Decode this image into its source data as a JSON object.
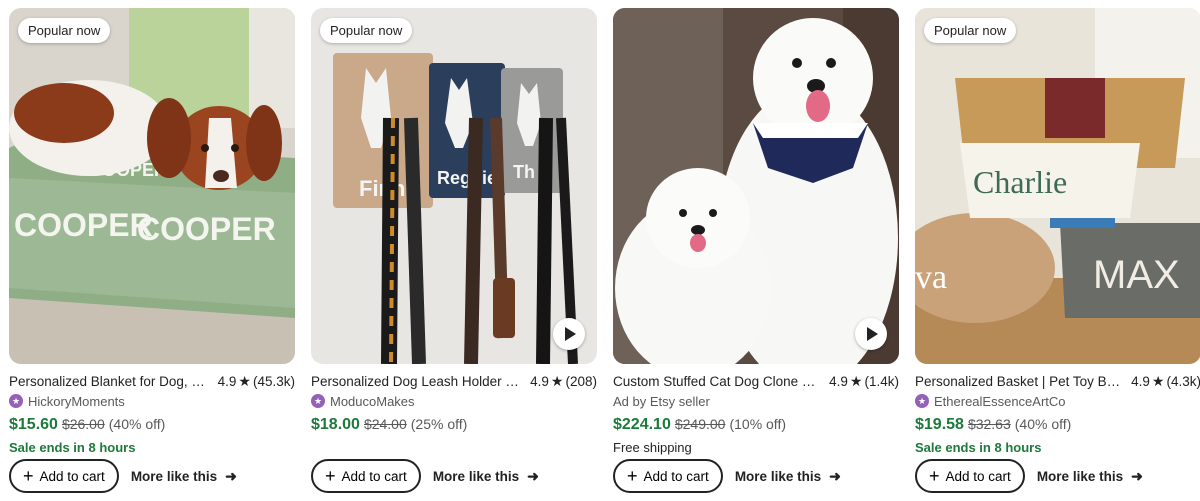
{
  "products": [
    {
      "badge": "Popular now",
      "title": "Personalized Blanket for Dog, Custom Dog Name Blanket",
      "rating": "4.9",
      "reviews": "(45.3k)",
      "seller": "HickoryMoments",
      "star_seller": true,
      "price": "$15.60",
      "original_price": "$26.00",
      "discount": "(40% off)",
      "extra": "Sale ends in 8 hours",
      "extra_type": "sale",
      "video": false,
      "image_desc": "dog-on-personalized-blanket",
      "cart_label": "Add to cart",
      "more_label": "More like this"
    },
    {
      "badge": "Popular now",
      "title": "Personalized Dog Leash Holder for Wall",
      "rating": "4.9",
      "reviews": "(208)",
      "seller": "ModucoMakes",
      "star_seller": true,
      "price": "$18.00",
      "original_price": "$24.00",
      "discount": "(25% off)",
      "extra": "",
      "extra_type": "none",
      "video": true,
      "image_desc": "leash-holder-with-leashes",
      "cart_label": "Add to cart",
      "more_label": "More like this"
    },
    {
      "badge": "",
      "title": "Custom Stuffed Cat Dog Clone Plush",
      "rating": "4.9",
      "reviews": "(1.4k)",
      "seller": "Ad by Etsy seller",
      "star_seller": false,
      "price": "$224.10",
      "original_price": "$249.00",
      "discount": "(10% off)",
      "extra": "Free shipping",
      "extra_type": "shipping",
      "video": true,
      "image_desc": "white-dog-and-plush-clone",
      "cart_label": "Add to cart",
      "more_label": "More like this"
    },
    {
      "badge": "Popular now",
      "title": "Personalized Basket | Pet Toy Basket",
      "rating": "4.9",
      "reviews": "(4.3k)",
      "seller": "EtherealEssenceArtCo",
      "star_seller": true,
      "price": "$19.58",
      "original_price": "$32.63",
      "discount": "(40% off)",
      "extra": "Sale ends in 8 hours",
      "extra_type": "sale",
      "video": false,
      "image_desc": "personalized-rope-baskets",
      "cart_label": "Add to cart",
      "more_label": "More like this"
    }
  ],
  "images": {
    "basket_names": [
      "Charlie",
      "MAX",
      "va"
    ],
    "blanket_name": "COOPER",
    "hook_names": [
      "Finn",
      "Reggie",
      "Th"
    ]
  },
  "colors": {
    "price_green": "#1d7a3a",
    "star_seller_purple": "#9560b8",
    "text": "#222222",
    "muted": "#595959"
  }
}
